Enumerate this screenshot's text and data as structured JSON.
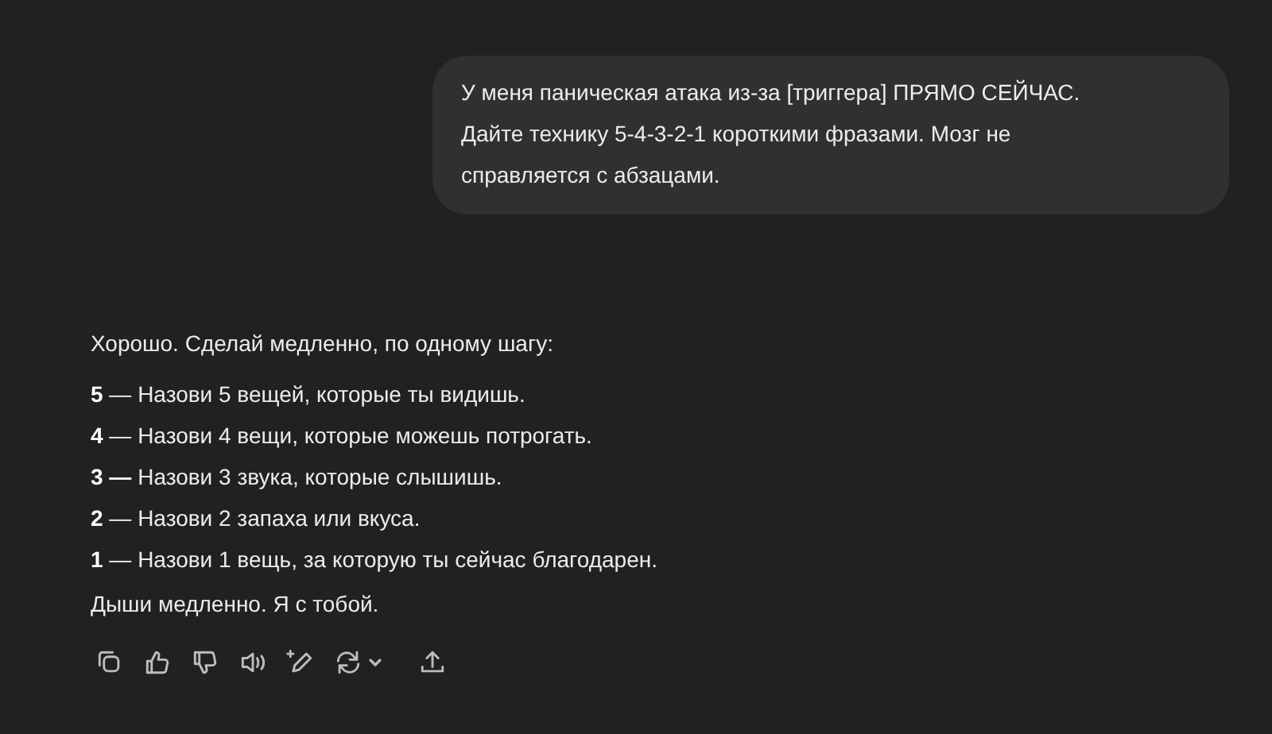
{
  "user_message": {
    "text": "У меня паническая атака из-за [триггера] ПРЯМО СЕЙЧАС. Дайте технику 5-4-3-2-1 короткими фразами. Мозг не справляется с абзацами."
  },
  "assistant_message": {
    "intro": "Хорошо. Сделай медленно, по одному шагу:",
    "steps": [
      "**5** — Назови 5 вещей, которые ты видишь.",
      "**4** — Назови 4 вещи, которые можешь потрогать.",
      "**3 —** Назови 3 звука, которые слышишь.",
      "**2** — Назови 2 запаха или вкуса.",
      "**1** — Назови 1 вещь, за которую ты сейчас благодарен."
    ],
    "outro": "Дыши медленно. Я с тобой."
  },
  "actions": [
    {
      "kind": "copy"
    },
    {
      "kind": "like"
    },
    {
      "kind": "dislike"
    },
    {
      "kind": "read-aloud"
    },
    {
      "kind": "edit"
    },
    {
      "kind": "regenerate"
    },
    {
      "kind": "share"
    }
  ]
}
